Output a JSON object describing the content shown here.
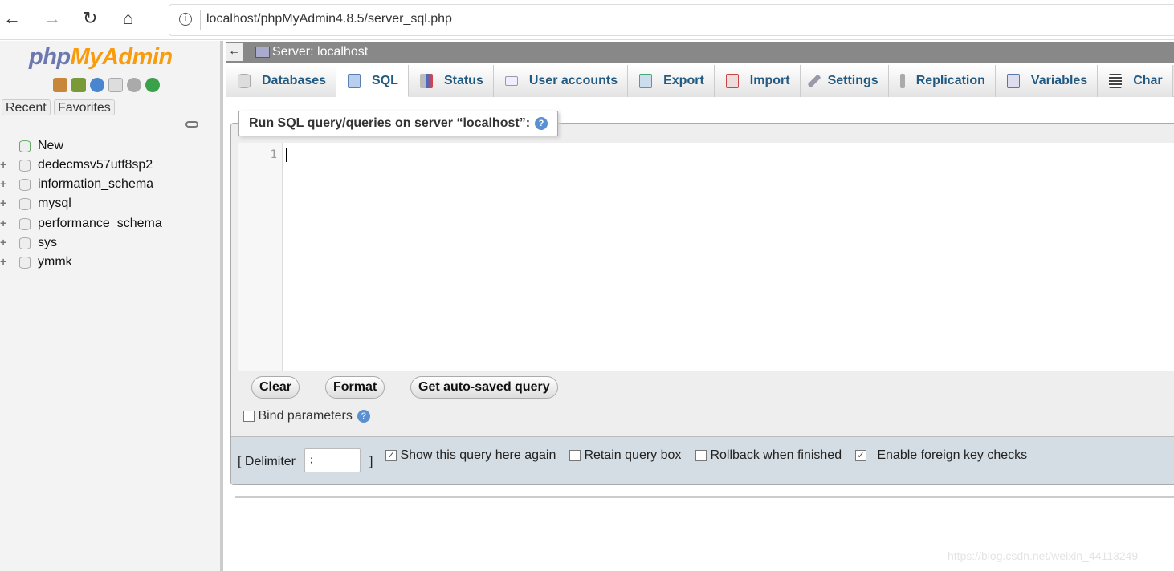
{
  "browser": {
    "url": "localhost/phpMyAdmin4.8.5/server_sql.php"
  },
  "sidebar": {
    "logo_php": "php",
    "logo_rest": "MyAdmin",
    "recent": "Recent",
    "favorites": "Favorites",
    "icons": [
      "home-icon",
      "logout-icon",
      "help-icon",
      "docs-icon",
      "settings-icon",
      "reload-icon"
    ],
    "tree": [
      "New",
      "dedecmsv57utf8sp2",
      "information_schema",
      "mysql",
      "performance_schema",
      "sys",
      "ymmk"
    ]
  },
  "serverbar": {
    "title": "Server: localhost"
  },
  "tabs": [
    {
      "label": "Databases",
      "icon": "database-icon"
    },
    {
      "label": "SQL",
      "icon": "sql-icon",
      "active": true
    },
    {
      "label": "Status",
      "icon": "status-icon"
    },
    {
      "label": "User accounts",
      "icon": "users-icon"
    },
    {
      "label": "Export",
      "icon": "export-icon"
    },
    {
      "label": "Import",
      "icon": "import-icon"
    },
    {
      "label": "Settings",
      "icon": "settings-icon"
    },
    {
      "label": "Replication",
      "icon": "replication-icon"
    },
    {
      "label": "Variables",
      "icon": "variables-icon"
    },
    {
      "label": "Char",
      "icon": "charset-icon"
    }
  ],
  "query": {
    "legend": "Run SQL query/queries on server “localhost”:",
    "line_number": "1",
    "clear": "Clear",
    "format": "Format",
    "autosaved": "Get auto-saved query",
    "bind_parameters": "Bind parameters",
    "delimiter_label": "[ Delimiter",
    "delimiter_value": ";",
    "delimiter_close": "]",
    "options": [
      {
        "label": "Show this query here again",
        "checked": true
      },
      {
        "label": "Retain query box",
        "checked": false
      },
      {
        "label": "Rollback when finished",
        "checked": false
      },
      {
        "label": "Enable foreign key checks",
        "checked": true
      }
    ]
  },
  "watermark": "https://blog.csdn.net/weixin_44113249"
}
